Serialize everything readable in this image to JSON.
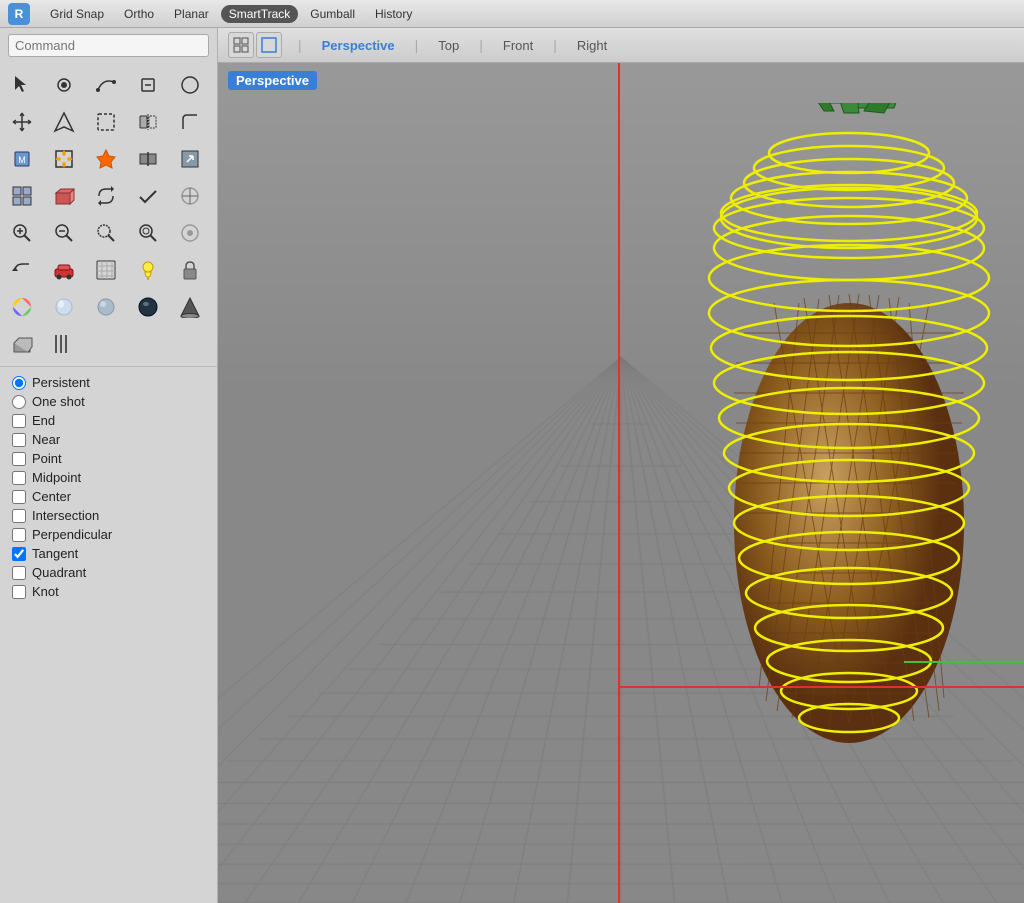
{
  "toolbar": {
    "app_icon": "R",
    "buttons": [
      {
        "label": "Grid Snap",
        "active": false
      },
      {
        "label": "Ortho",
        "active": false
      },
      {
        "label": "Planar",
        "active": false
      },
      {
        "label": "SmartTrack",
        "active": true
      },
      {
        "label": "Gumball",
        "active": false
      },
      {
        "label": "History",
        "active": false
      }
    ]
  },
  "command_input": {
    "placeholder": "Command"
  },
  "view_tabs": {
    "perspective_label": "Perspective",
    "tabs": [
      {
        "label": "Perspective",
        "active": true
      },
      {
        "label": "Top",
        "active": false
      },
      {
        "label": "Front",
        "active": false
      },
      {
        "label": "Right",
        "active": false
      }
    ]
  },
  "snap_options": {
    "modes": [
      {
        "label": "Persistent",
        "type": "radio",
        "checked": true
      },
      {
        "label": "One shot",
        "type": "radio",
        "checked": false
      }
    ],
    "snaps": [
      {
        "label": "End",
        "checked": false
      },
      {
        "label": "Near",
        "checked": false
      },
      {
        "label": "Point",
        "checked": false
      },
      {
        "label": "Midpoint",
        "checked": false
      },
      {
        "label": "Center",
        "checked": false
      },
      {
        "label": "Intersection",
        "checked": false
      },
      {
        "label": "Perpendicular",
        "checked": false
      },
      {
        "label": "Tangent",
        "checked": true
      },
      {
        "label": "Quadrant",
        "checked": false
      },
      {
        "label": "Knot",
        "checked": false
      }
    ]
  },
  "tools": {
    "rows": 11
  }
}
